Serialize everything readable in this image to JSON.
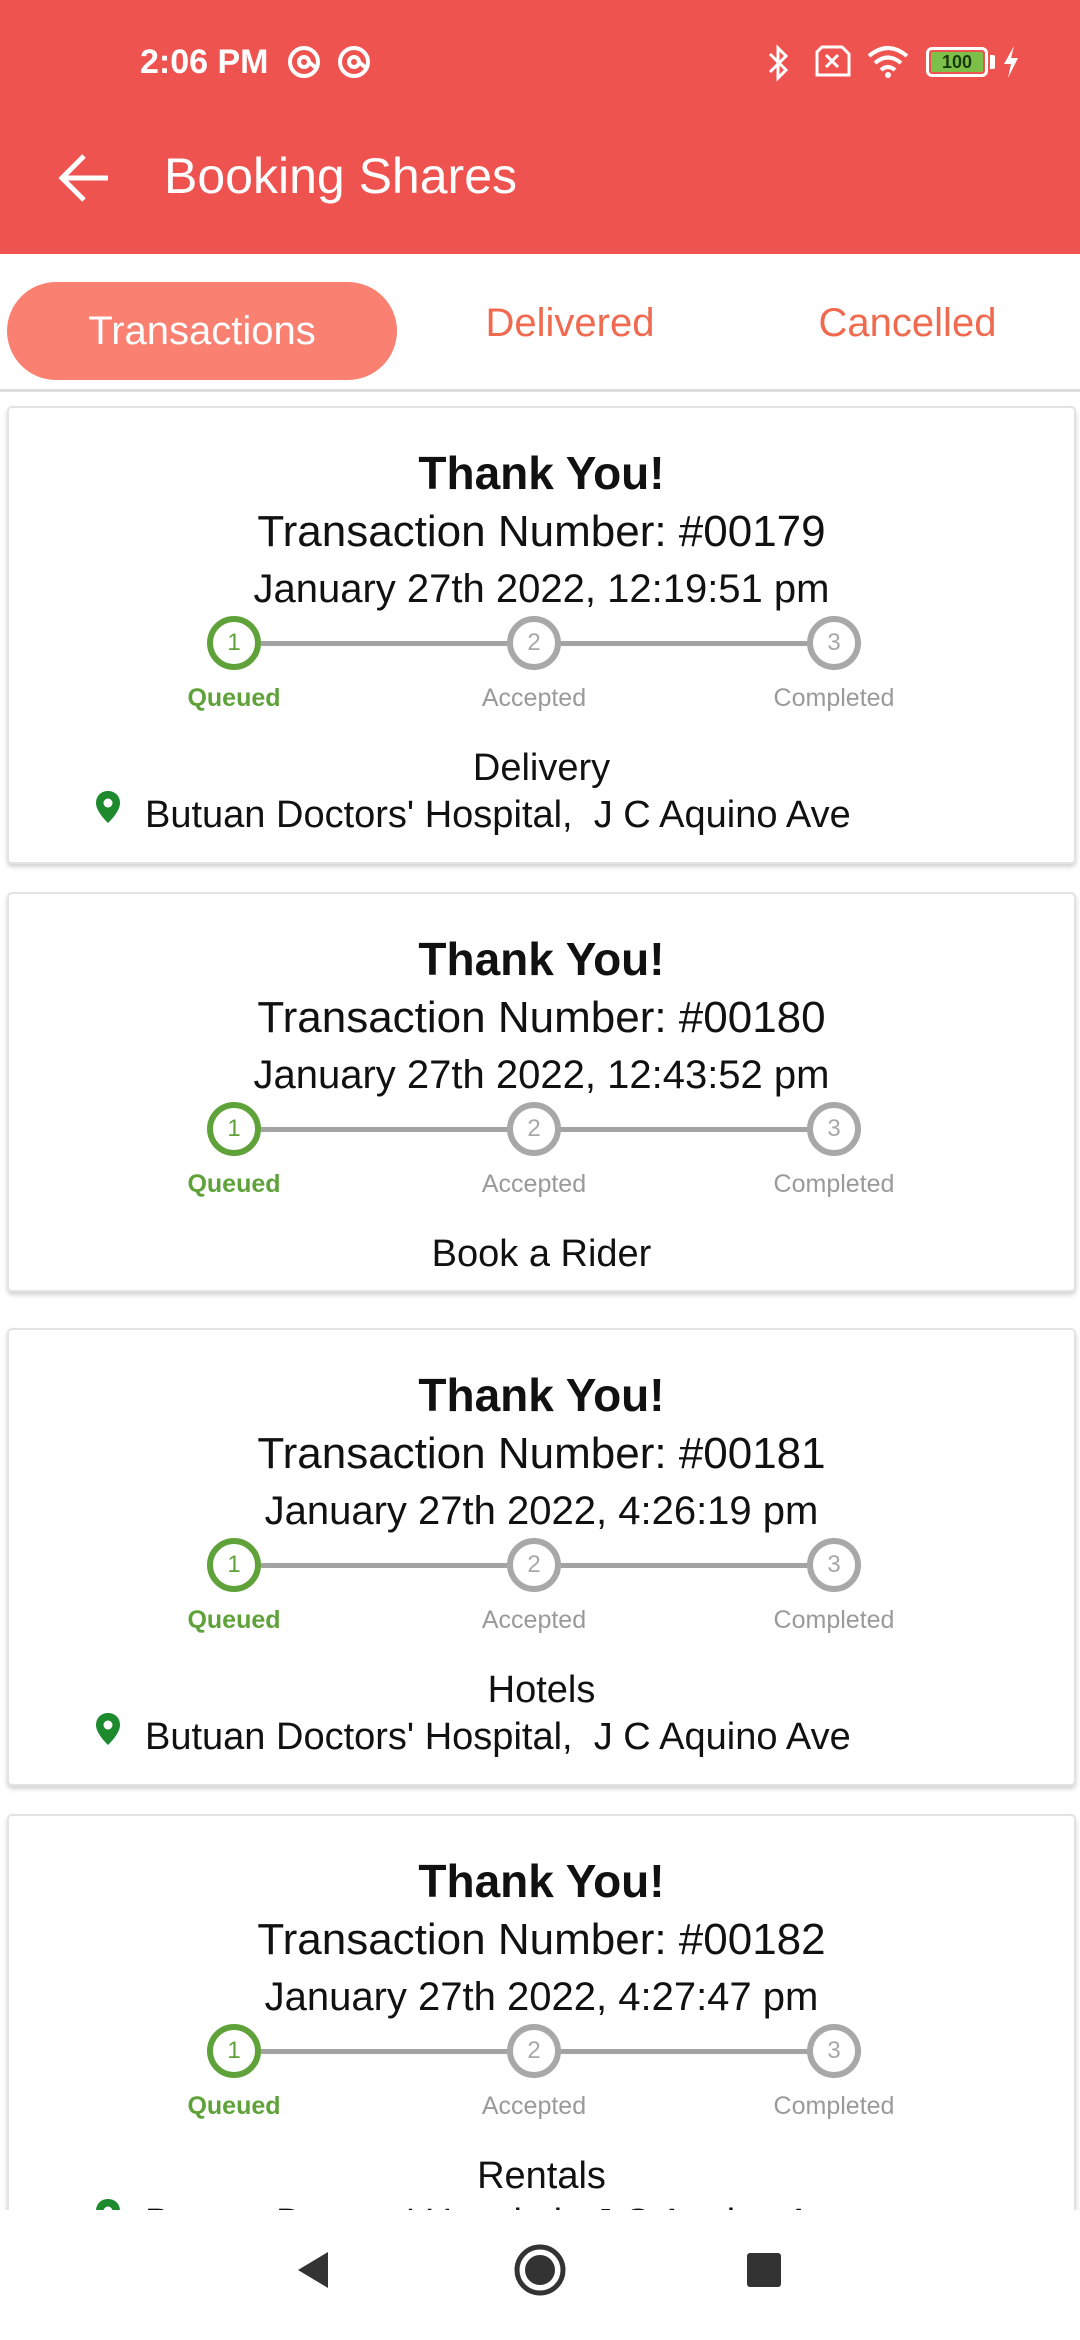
{
  "status_bar": {
    "time": "2:06 PM",
    "battery": "100",
    "icons": [
      "at-icon",
      "at-icon",
      "bluetooth-icon",
      "no-sim-icon",
      "wifi-icon",
      "battery-icon",
      "charging-icon"
    ]
  },
  "app_bar": {
    "title": "Booking Shares",
    "back_icon": "arrow-left-icon"
  },
  "tabs": [
    {
      "label": "Transactions",
      "active": true
    },
    {
      "label": "Delivered",
      "active": false
    },
    {
      "label": "Cancelled",
      "active": false
    }
  ],
  "steps": [
    {
      "number": "1",
      "label": "Queued"
    },
    {
      "number": "2",
      "label": "Accepted"
    },
    {
      "number": "3",
      "label": "Completed"
    }
  ],
  "cards": [
    {
      "title": "Thank You!",
      "transaction": "Transaction Number: #00179",
      "date": "January 27th 2022, 12:19:51 pm",
      "current_step": 1,
      "type": "Delivery",
      "location": "Butuan Doctors' Hospital,  J C Aquino Ave"
    },
    {
      "title": "Thank You!",
      "transaction": "Transaction Number: #00180",
      "date": "January 27th 2022, 12:43:52 pm",
      "current_step": 1,
      "type": "Book a Rider",
      "location": ""
    },
    {
      "title": "Thank You!",
      "transaction": "Transaction Number: #00181",
      "date": "January 27th 2022, 4:26:19 pm",
      "current_step": 1,
      "type": "Hotels",
      "location": "Butuan Doctors' Hospital,  J C Aquino Ave"
    },
    {
      "title": "Thank You!",
      "transaction": "Transaction Number: #00182",
      "date": "January 27th 2022, 4:27:47 pm",
      "current_step": 1,
      "type": "Rentals",
      "location": "Butuan Doctors' Hospital,  J C Aquino Ave"
    }
  ],
  "colors": {
    "header": "#ef5350",
    "active_tab": "#fa8072",
    "tab_text": "#f06a4f",
    "step_done": "#5fa23a",
    "step_pending": "#a8a8a8",
    "pin": "#1e8a2e"
  },
  "nav_bar": {
    "icons": [
      "back-triangle-icon",
      "home-circle-icon",
      "recents-square-icon"
    ]
  }
}
